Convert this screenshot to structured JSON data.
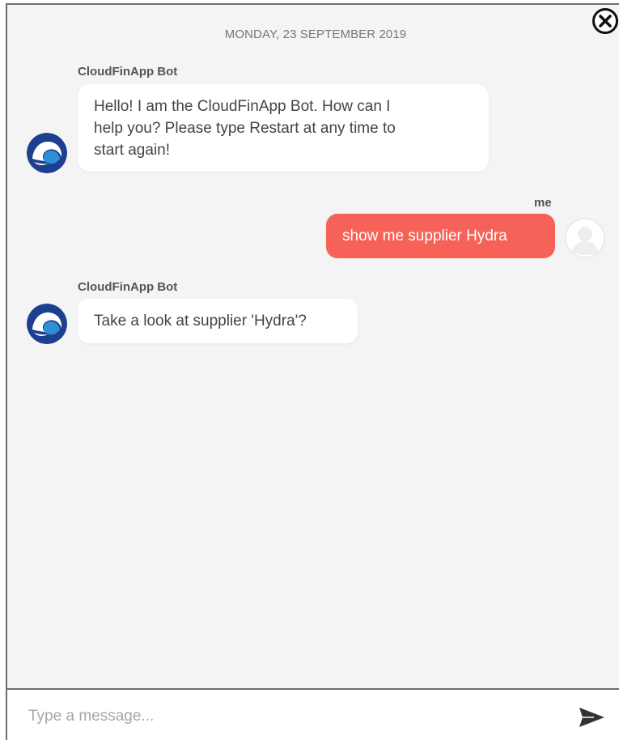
{
  "chat": {
    "date_separator": "MONDAY, 23 SEPTEMBER 2019",
    "messages": [
      {
        "sender": "CloudFinApp Bot",
        "text_lines": [
          "Hello! I am the CloudFinApp Bot. How can I",
          "help you? Please type Restart at any time to",
          "start again!"
        ]
      },
      {
        "sender": "me",
        "text": "show me supplier Hydra"
      },
      {
        "sender": "CloudFinApp Bot",
        "text": "Take a look at supplier 'Hydra'?"
      }
    ]
  },
  "composer": {
    "placeholder": "Type a message...",
    "value": ""
  },
  "icons": {
    "close": "close-circle-icon",
    "send": "send-icon",
    "bot_avatar": "cloudfinapp-logo",
    "user_avatar": "default-user-avatar"
  },
  "colors": {
    "user_bubble": "#f76258",
    "bot_bubble": "#ffffff",
    "background": "#f4f4f4",
    "bot_logo_dark": "#1d3f8f",
    "bot_logo_light": "#2d8fd5"
  }
}
